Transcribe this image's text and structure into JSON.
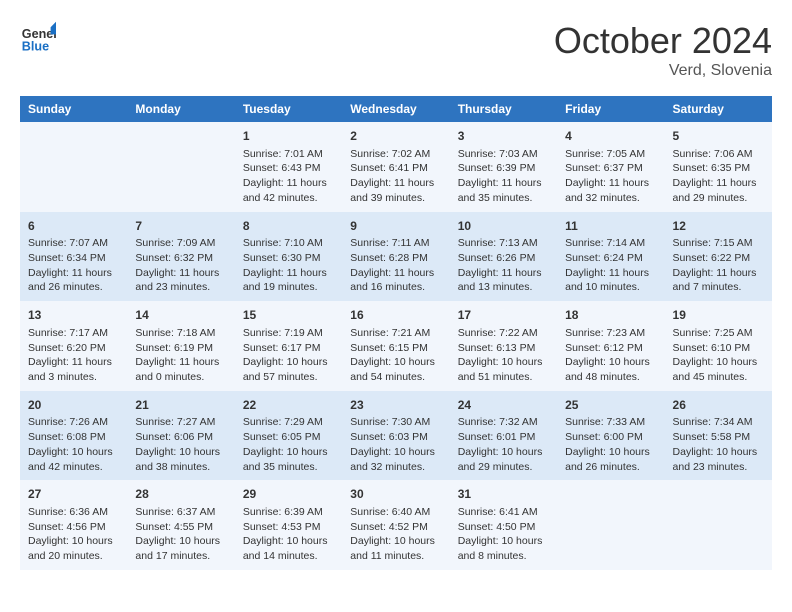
{
  "header": {
    "logo_general": "General",
    "logo_blue": "Blue",
    "month_title": "October 2024",
    "location": "Verd, Slovenia"
  },
  "weekdays": [
    "Sunday",
    "Monday",
    "Tuesday",
    "Wednesday",
    "Thursday",
    "Friday",
    "Saturday"
  ],
  "weeks": [
    [
      {
        "day": "",
        "info": ""
      },
      {
        "day": "",
        "info": ""
      },
      {
        "day": "1",
        "info": "Sunrise: 7:01 AM\nSunset: 6:43 PM\nDaylight: 11 hours and 42 minutes."
      },
      {
        "day": "2",
        "info": "Sunrise: 7:02 AM\nSunset: 6:41 PM\nDaylight: 11 hours and 39 minutes."
      },
      {
        "day": "3",
        "info": "Sunrise: 7:03 AM\nSunset: 6:39 PM\nDaylight: 11 hours and 35 minutes."
      },
      {
        "day": "4",
        "info": "Sunrise: 7:05 AM\nSunset: 6:37 PM\nDaylight: 11 hours and 32 minutes."
      },
      {
        "day": "5",
        "info": "Sunrise: 7:06 AM\nSunset: 6:35 PM\nDaylight: 11 hours and 29 minutes."
      }
    ],
    [
      {
        "day": "6",
        "info": "Sunrise: 7:07 AM\nSunset: 6:34 PM\nDaylight: 11 hours and 26 minutes."
      },
      {
        "day": "7",
        "info": "Sunrise: 7:09 AM\nSunset: 6:32 PM\nDaylight: 11 hours and 23 minutes."
      },
      {
        "day": "8",
        "info": "Sunrise: 7:10 AM\nSunset: 6:30 PM\nDaylight: 11 hours and 19 minutes."
      },
      {
        "day": "9",
        "info": "Sunrise: 7:11 AM\nSunset: 6:28 PM\nDaylight: 11 hours and 16 minutes."
      },
      {
        "day": "10",
        "info": "Sunrise: 7:13 AM\nSunset: 6:26 PM\nDaylight: 11 hours and 13 minutes."
      },
      {
        "day": "11",
        "info": "Sunrise: 7:14 AM\nSunset: 6:24 PM\nDaylight: 11 hours and 10 minutes."
      },
      {
        "day": "12",
        "info": "Sunrise: 7:15 AM\nSunset: 6:22 PM\nDaylight: 11 hours and 7 minutes."
      }
    ],
    [
      {
        "day": "13",
        "info": "Sunrise: 7:17 AM\nSunset: 6:20 PM\nDaylight: 11 hours and 3 minutes."
      },
      {
        "day": "14",
        "info": "Sunrise: 7:18 AM\nSunset: 6:19 PM\nDaylight: 11 hours and 0 minutes."
      },
      {
        "day": "15",
        "info": "Sunrise: 7:19 AM\nSunset: 6:17 PM\nDaylight: 10 hours and 57 minutes."
      },
      {
        "day": "16",
        "info": "Sunrise: 7:21 AM\nSunset: 6:15 PM\nDaylight: 10 hours and 54 minutes."
      },
      {
        "day": "17",
        "info": "Sunrise: 7:22 AM\nSunset: 6:13 PM\nDaylight: 10 hours and 51 minutes."
      },
      {
        "day": "18",
        "info": "Sunrise: 7:23 AM\nSunset: 6:12 PM\nDaylight: 10 hours and 48 minutes."
      },
      {
        "day": "19",
        "info": "Sunrise: 7:25 AM\nSunset: 6:10 PM\nDaylight: 10 hours and 45 minutes."
      }
    ],
    [
      {
        "day": "20",
        "info": "Sunrise: 7:26 AM\nSunset: 6:08 PM\nDaylight: 10 hours and 42 minutes."
      },
      {
        "day": "21",
        "info": "Sunrise: 7:27 AM\nSunset: 6:06 PM\nDaylight: 10 hours and 38 minutes."
      },
      {
        "day": "22",
        "info": "Sunrise: 7:29 AM\nSunset: 6:05 PM\nDaylight: 10 hours and 35 minutes."
      },
      {
        "day": "23",
        "info": "Sunrise: 7:30 AM\nSunset: 6:03 PM\nDaylight: 10 hours and 32 minutes."
      },
      {
        "day": "24",
        "info": "Sunrise: 7:32 AM\nSunset: 6:01 PM\nDaylight: 10 hours and 29 minutes."
      },
      {
        "day": "25",
        "info": "Sunrise: 7:33 AM\nSunset: 6:00 PM\nDaylight: 10 hours and 26 minutes."
      },
      {
        "day": "26",
        "info": "Sunrise: 7:34 AM\nSunset: 5:58 PM\nDaylight: 10 hours and 23 minutes."
      }
    ],
    [
      {
        "day": "27",
        "info": "Sunrise: 6:36 AM\nSunset: 4:56 PM\nDaylight: 10 hours and 20 minutes."
      },
      {
        "day": "28",
        "info": "Sunrise: 6:37 AM\nSunset: 4:55 PM\nDaylight: 10 hours and 17 minutes."
      },
      {
        "day": "29",
        "info": "Sunrise: 6:39 AM\nSunset: 4:53 PM\nDaylight: 10 hours and 14 minutes."
      },
      {
        "day": "30",
        "info": "Sunrise: 6:40 AM\nSunset: 4:52 PM\nDaylight: 10 hours and 11 minutes."
      },
      {
        "day": "31",
        "info": "Sunrise: 6:41 AM\nSunset: 4:50 PM\nDaylight: 10 hours and 8 minutes."
      },
      {
        "day": "",
        "info": ""
      },
      {
        "day": "",
        "info": ""
      }
    ]
  ]
}
